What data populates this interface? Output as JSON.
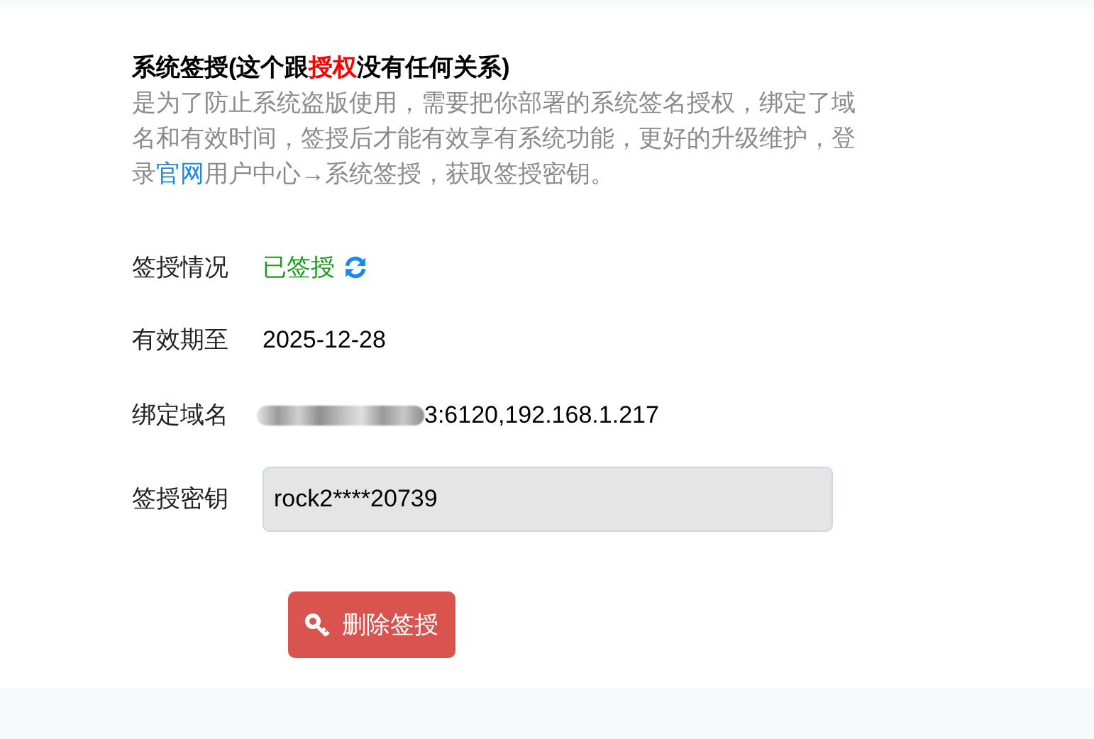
{
  "heading": [
    {
      "kind": "plain",
      "text": "系统签授(这个跟"
    },
    {
      "kind": "highlight",
      "text": "授权"
    },
    {
      "kind": "plain",
      "text": "没有任何关系)"
    }
  ],
  "description": [
    {
      "kind": "text",
      "text": "是为了防止系统盗版使用，需要把你部署的系统签名授权，绑定了域名和有效时间，签授后才能有效享有系统功能，更好的升级维护，登录"
    },
    {
      "kind": "link",
      "text": "官网"
    },
    {
      "kind": "text",
      "text": "用户中心→系统签授，获取签授密钥。"
    }
  ],
  "fields": [
    {
      "kind": "status",
      "label": "签授情况",
      "value": "已签授"
    },
    {
      "kind": "text",
      "label": "有效期至",
      "value": "2025-12-28"
    },
    {
      "kind": "redacted",
      "label": "绑定域名",
      "value": "3:6120,192.168.1.217"
    },
    {
      "kind": "input",
      "label": "签授密钥",
      "value": "rock2****20739"
    }
  ],
  "button": {
    "label": "删除签授"
  }
}
